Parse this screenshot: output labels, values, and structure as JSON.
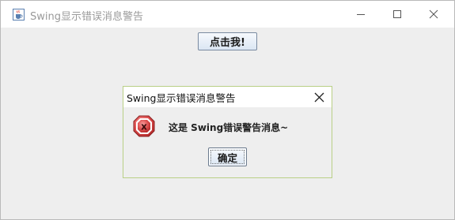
{
  "window": {
    "title": "Swing显示错误消息警告",
    "icon": "java-cup-icon",
    "controls": [
      "minimize-icon",
      "maximize-icon",
      "close-icon"
    ]
  },
  "main": {
    "button_label": "点击我!"
  },
  "dialog": {
    "title": "Swing显示错误消息警告",
    "icon": "error-icon",
    "message": "这是 Swing错误警告消息~",
    "ok_label": "确定"
  },
  "colors": {
    "window_bg": "#eeeeee",
    "titlebar_bg": "#ffffff",
    "dialog_border": "#b9cf86",
    "error_red": "#d63b3b"
  }
}
